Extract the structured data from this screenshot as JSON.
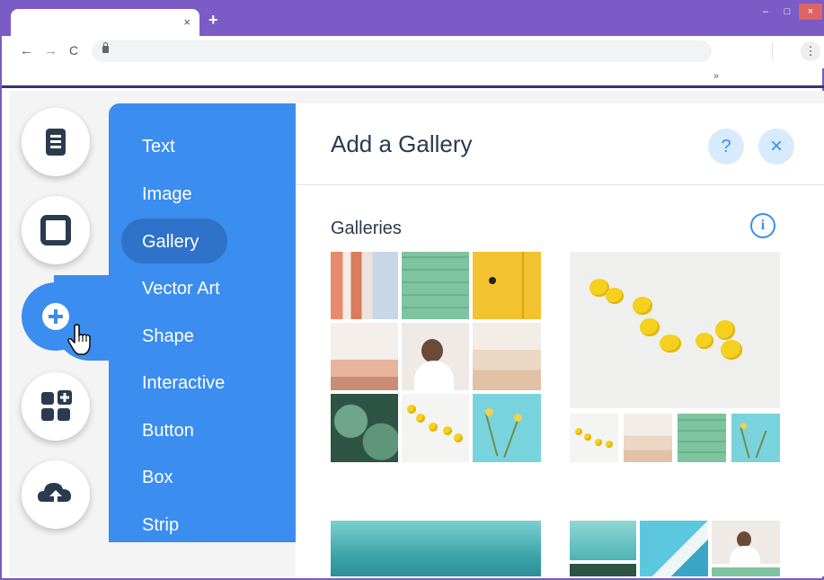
{
  "browser": {
    "tab_close": "×",
    "new_tab": "+",
    "window_controls": {
      "minimize": "–",
      "maximize": "□",
      "close": "×"
    },
    "nav": {
      "back": "←",
      "forward": "→",
      "reload": "C"
    },
    "menu_glyph": "⋮",
    "bookmarks_overflow": "»"
  },
  "rail": {
    "items": [
      {
        "icon": "pages-icon"
      },
      {
        "icon": "background-icon"
      },
      {
        "icon": "add-icon",
        "active": true
      },
      {
        "icon": "add-apps-icon"
      },
      {
        "icon": "upload-icon"
      }
    ]
  },
  "add_menu": {
    "items": [
      "Text",
      "Image",
      "Gallery",
      "Vector Art",
      "Shape",
      "Interactive",
      "Button",
      "Box",
      "Strip"
    ],
    "selected": "Gallery"
  },
  "panel": {
    "title": "Add a Gallery",
    "help_label": "?",
    "close_label": "×",
    "section_title": "Galleries",
    "info_label": "i"
  },
  "colors": {
    "accent": "#3b8df0",
    "accent_dark": "#2e72c9",
    "browser_frame": "#7b5bc6"
  }
}
